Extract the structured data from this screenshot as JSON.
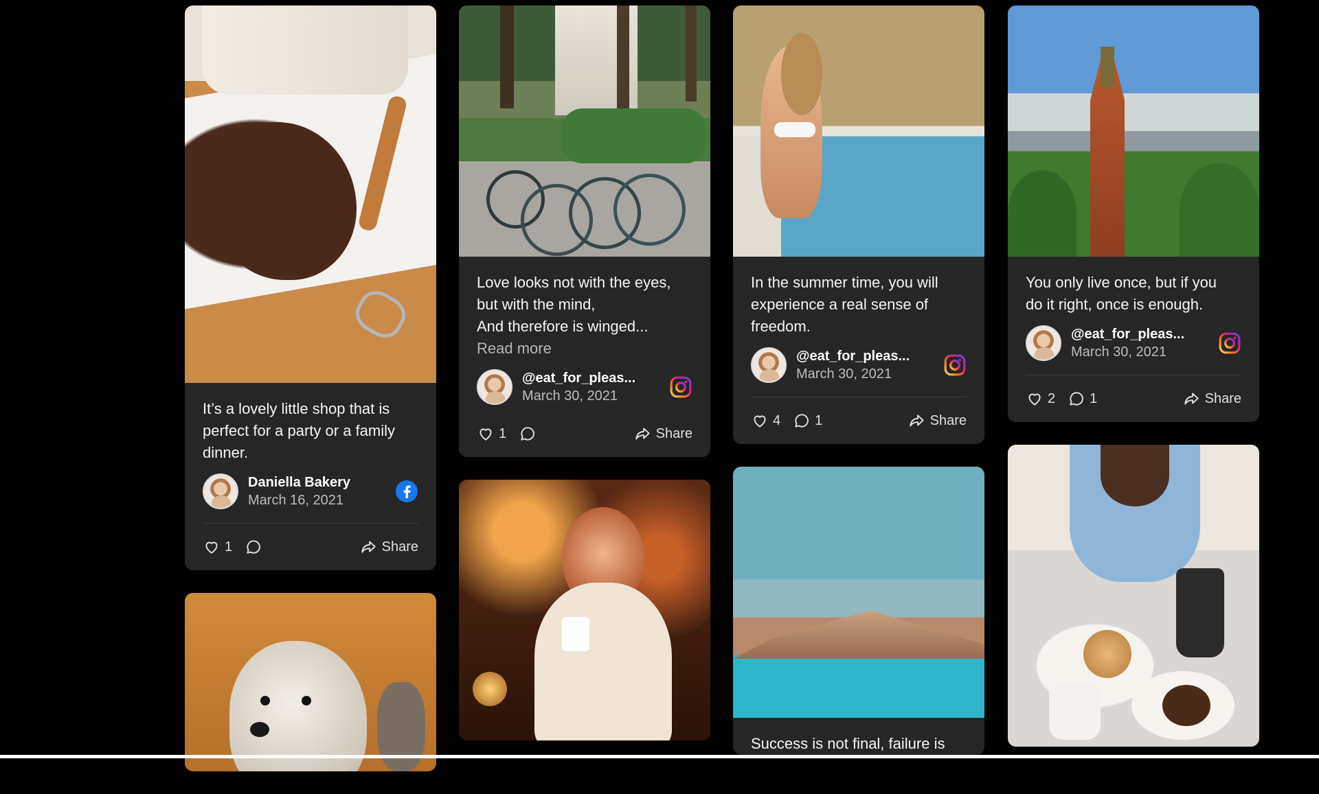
{
  "posts": [
    {
      "text": "It’s a lovely little shop that is\nperfect for a party or a family\ndinner.",
      "author": "Daniella Bakery",
      "date": "March 16, 2021",
      "network": "facebook-icon",
      "likes": "1",
      "comments": "",
      "share_label": "Share"
    },
    {
      "text": "Love looks not with the eyes,\nbut with the mind,\nAnd therefore is winged...",
      "read_more": "Read more",
      "author": "@eat_for_pleas...",
      "date": "March 30, 2021",
      "network": "instagram-icon",
      "likes": "1",
      "comments": "",
      "share_label": "Share"
    },
    {
      "text": "In the summer time, you will\nexperience a real sense of\nfreedom.",
      "author": "@eat_for_pleas...",
      "date": "March 30, 2021",
      "network": "instagram-icon",
      "likes": "4",
      "comments": "1",
      "share_label": "Share"
    },
    {
      "text": "You only live once, but if you\ndo it right, once is enough.",
      "author": "@eat_for_pleas...",
      "date": "March 30, 2021",
      "network": "instagram-icon",
      "likes": "2",
      "comments": "1",
      "share_label": "Share"
    },
    {
      "text": "Success is not final, failure is"
    }
  ],
  "colors": {
    "background": "#000000",
    "card": "#262626",
    "facebook": "#1877f2",
    "instagram_gradient": [
      "#feda75",
      "#fa7e1e",
      "#d62976",
      "#962fbf",
      "#4f5bd5"
    ]
  }
}
